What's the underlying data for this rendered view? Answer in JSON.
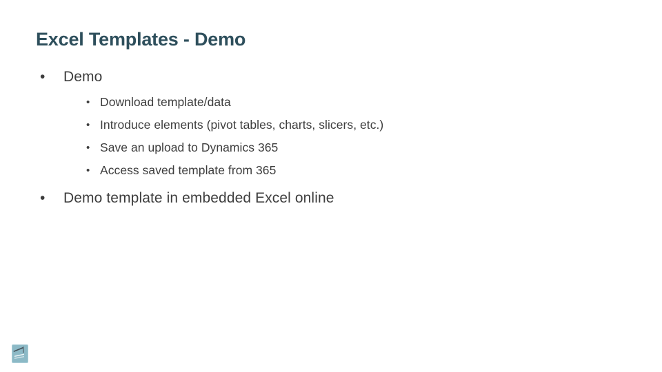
{
  "slide": {
    "title": "Excel Templates - Demo",
    "bullet_glyph": "•",
    "colors": {
      "title": "#2e4f5c",
      "body_text": "#3d3d3d",
      "background": "#ffffff",
      "icon_fill": "#8cb9c6",
      "icon_detail": "#46545c"
    },
    "content": [
      {
        "level": 1,
        "text": "Demo"
      },
      {
        "level": 2,
        "text": "Download template/data"
      },
      {
        "level": 2,
        "text": "Introduce elements (pivot tables, charts, slicers, etc.)"
      },
      {
        "level": 2,
        "text": "Save an upload to Dynamics 365"
      },
      {
        "level": 2,
        "text": "Access saved template from 365"
      },
      {
        "level": 1,
        "text": "Demo template in embedded Excel online"
      }
    ],
    "corner_icon": {
      "name": "slide-thumbnail-icon"
    }
  }
}
